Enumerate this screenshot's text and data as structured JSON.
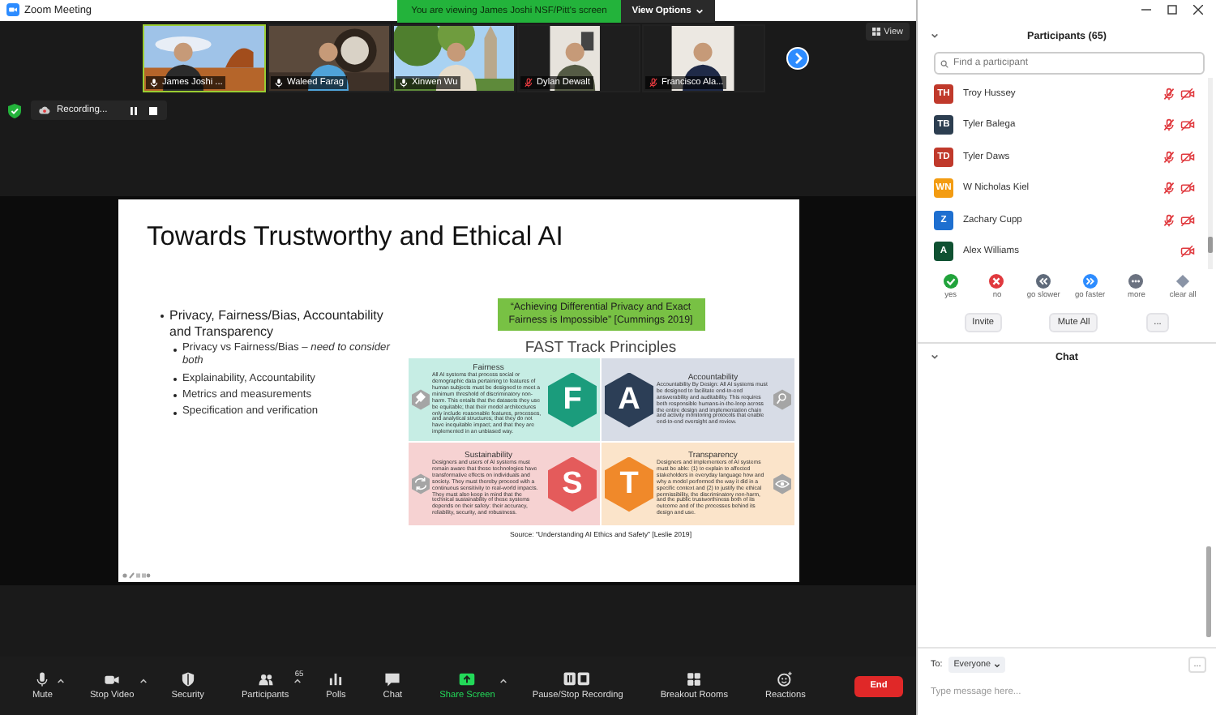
{
  "window": {
    "title": "Zoom Meeting"
  },
  "share_banner": {
    "text": "You are viewing James Joshi NSF/Pitt's screen",
    "view_options": "View Options"
  },
  "video_strip": {
    "tiles": [
      {
        "name": "James Joshi ...",
        "mic_muted": false,
        "selected": true
      },
      {
        "name": "Waleed Farag",
        "mic_muted": false,
        "selected": false
      },
      {
        "name": "Xinwen Wu",
        "mic_muted": false,
        "selected": false
      },
      {
        "name": "Dylan Dewalt",
        "mic_muted": true,
        "selected": false
      },
      {
        "name": "Francisco Ala...",
        "mic_muted": true,
        "selected": false
      }
    ],
    "view_button": "View"
  },
  "recording": {
    "label": "Recording..."
  },
  "slide": {
    "title": "Towards Trustworthy and Ethical AI",
    "bullets": [
      {
        "text": "Privacy, Fairness/Bias, Accountability and Transparency",
        "children": [
          {
            "text": "Privacy vs Fairness/Bias – *need to consider both*"
          },
          {
            "text": "Explainability, Accountability"
          },
          {
            "text": "Metrics and measurements"
          },
          {
            "text": "Specification and verification"
          }
        ]
      }
    ],
    "quote": "“Achieving Differential Privacy and Exact Fairness is Impossible” [Cummings 2019]",
    "figure_title": "FAST Track Principles",
    "principles": [
      {
        "letter": "F",
        "title": "Fairness",
        "kind": "gavel",
        "color": "#1b9c7c",
        "body": "All AI systems that process social or demographic data pertaining to features of human subjects must be designed to meet a minimum threshold of discriminatory non-harm. This entails that the datasets they use be equitable; that their model architectures only include reasonable features, processes, and analytical structures; that they do not have inequitable impact; and that they are implemented in an unbiased way."
      },
      {
        "letter": "A",
        "title": "Accountability",
        "kind": "magnifier",
        "color": "#2c3e56",
        "body": "Accountability By Design: All AI systems must be designed to facilitate end-to-end answerability and auditability. This requires both responsible humans-in-the-loop across the entire design and implementation chain and activity monitoring protocols that enable end-to-end oversight and review."
      },
      {
        "letter": "S",
        "title": "Sustainability",
        "kind": "cycle",
        "color": "#e45b5b",
        "body": "Designers and users of AI systems must remain aware that these technologies have transformative effects on individuals and society. They must thereby proceed with a continuous sensitivity to real-world impacts. They must also keep in mind that the technical sustainability of these systems depends on their safety: their accuracy, reliability, security, and robustness."
      },
      {
        "letter": "T",
        "title": "Transparency",
        "kind": "eye",
        "color": "#f0892a",
        "body": "Designers and implementers of AI systems must be able: (1) to explain to affected stakeholders in everyday language how and why a model performed the way it did in a specific context and (2) to justify the ethical permissibility, the discriminatory non-harm, and the public trustworthiness both of its outcome and of the processes behind its design and use."
      }
    ],
    "source": "Source: “Understanding AI Ethics and Safety” [Leslie 2019]"
  },
  "participants": {
    "title": "Participants (65)",
    "search": {
      "placeholder": "Find a participant"
    },
    "people": [
      {
        "initials": "TH",
        "name": "Troy Hussey",
        "color": "#c0392b",
        "mic_muted": true,
        "video_off": true
      },
      {
        "initials": "TB",
        "name": "Tyler Balega",
        "color": "#2c3e50",
        "mic_muted": true,
        "video_off": true
      },
      {
        "initials": "TD",
        "name": "Tyler Daws",
        "color": "#c0392b",
        "mic_muted": true,
        "video_off": true
      },
      {
        "initials": "WN",
        "name": "W Nicholas Kiel",
        "color": "#f39c12",
        "mic_muted": true,
        "video_off": true
      },
      {
        "initials": "Z",
        "name": "Zachary Cupp",
        "color": "#1e6fd0",
        "mic_muted": true,
        "video_off": true
      },
      {
        "initials": "A",
        "name": "Alex Williams",
        "color": "#0f5132",
        "mic_muted": false,
        "video_off": true
      }
    ],
    "reactions": [
      {
        "label": "yes",
        "kind": "yes"
      },
      {
        "label": "no",
        "kind": "no"
      },
      {
        "label": "go slower",
        "kind": "slower"
      },
      {
        "label": "go faster",
        "kind": "faster"
      },
      {
        "label": "more",
        "kind": "more"
      },
      {
        "label": "clear all",
        "kind": "clear"
      }
    ],
    "buttons": [
      "Invite",
      "Mute All",
      "..."
    ]
  },
  "chat": {
    "title": "Chat",
    "to_label": "To:",
    "recipient": "Everyone",
    "placeholder": "Type message here...",
    "more": "..."
  },
  "toolbar": {
    "items": [
      {
        "label": "Mute",
        "kind": "mic",
        "caret": true
      },
      {
        "label": "Stop Video",
        "kind": "video",
        "caret": true
      },
      {
        "label": "Security",
        "kind": "security",
        "caret": false
      },
      {
        "label": "Participants",
        "kind": "participants",
        "count": "65",
        "caret": true
      },
      {
        "label": "Polls",
        "kind": "polls",
        "caret": false
      },
      {
        "label": "Chat",
        "kind": "chat",
        "caret": false
      },
      {
        "label": "Share Screen",
        "kind": "share",
        "caret": true
      },
      {
        "label": "Pause/Stop Recording",
        "kind": "record",
        "caret": false
      },
      {
        "label": "Breakout Rooms",
        "kind": "breakout",
        "caret": false
      },
      {
        "label": "Reactions",
        "kind": "reactions",
        "caret": false
      }
    ],
    "end": "End"
  }
}
